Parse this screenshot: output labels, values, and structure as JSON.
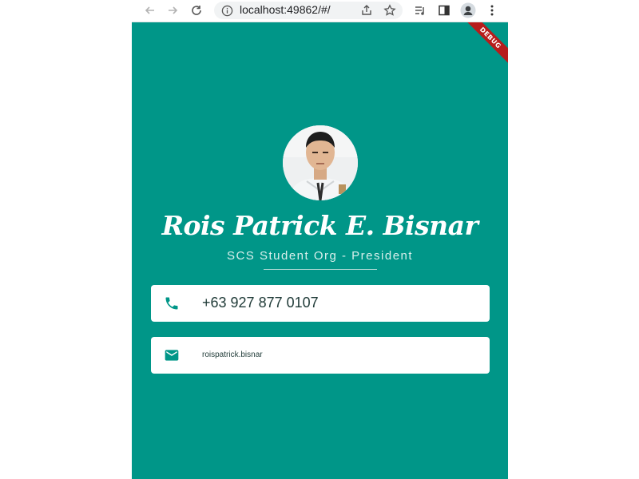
{
  "browser": {
    "url": "localhost:49862/#/"
  },
  "app": {
    "debug_banner": "DEBUG",
    "profile": {
      "name": "Rois Patrick E. Bisnar",
      "title": "SCS Student Org - President"
    },
    "contacts": [
      {
        "type": "phone",
        "icon": "phone-icon",
        "value": "+63 927 877 0107"
      },
      {
        "type": "email",
        "icon": "email-icon",
        "value": "roispatrick.bisnar"
      }
    ],
    "colors": {
      "background": "#009688",
      "card": "#ffffff",
      "icon": "#009688",
      "debug_ribbon": "#b71c1c"
    }
  }
}
